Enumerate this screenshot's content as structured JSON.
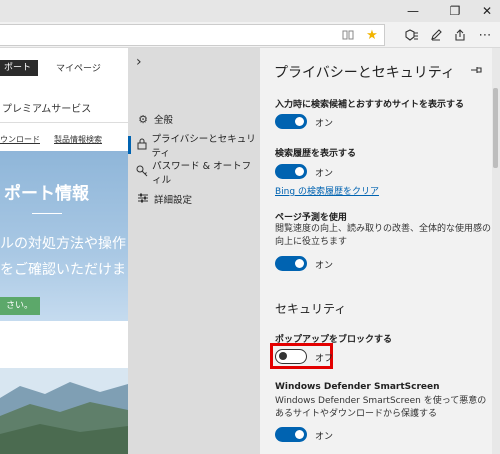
{
  "browser": {
    "window_buttons": {
      "minimize": "—",
      "maximize": "❐",
      "close": "✕"
    },
    "toolbar_icons": {
      "reading_view": "reading-view-icon",
      "favorite": "star-icon",
      "hub": "hub-icon",
      "notes": "pen-icon",
      "share": "share-icon",
      "more": "more-icon"
    },
    "favorite_color": "#f2b400"
  },
  "page": {
    "nav_support": "ポート",
    "nav_mypage": "マイページ",
    "premium": "プレミアムサービス",
    "link_download": "ウンロード",
    "link_product_search": "製品情報検索",
    "hero_title": "ポート情報",
    "hero_line1": "ルの対処方法や操作",
    "hero_line2": "をご確認いただけま",
    "hero_button": "さい。"
  },
  "settings_nav": {
    "items": [
      {
        "label": "全般",
        "icon": "gear-icon"
      },
      {
        "label": "プライバシーとセキュリティ",
        "icon": "lock-icon"
      },
      {
        "label": "パスワード & オートフィル",
        "icon": "key-icon"
      },
      {
        "label": "詳細設定",
        "icon": "sliders-icon"
      }
    ],
    "active_color": "#0063b1"
  },
  "panel": {
    "title": "プライバシーとセキュリティ",
    "search_suggestions": {
      "label": "入力時に検索候補とおすすめサイトを表示する",
      "state": "オン"
    },
    "search_history": {
      "label": "検索履歴を表示する",
      "state": "オン",
      "clear_link": "Bing の検索履歴をクリア"
    },
    "page_prediction": {
      "label": "ページ予測を使用",
      "desc": "閲覧速度の向上、読み取りの改善、全体的な使用感の向上に役立ちます",
      "state": "オン"
    },
    "security_heading": "セキュリティ",
    "popup_block": {
      "label": "ポップアップをブロックする",
      "state": "オフ"
    },
    "smartscreen": {
      "label": "Windows Defender SmartScreen",
      "desc": "Windows Defender SmartScreen を使って悪意のあるサイトやダウンロードから保護する",
      "state": "オン"
    },
    "toggle_on_color": "#0063b1",
    "highlight_color": "#e30000"
  }
}
